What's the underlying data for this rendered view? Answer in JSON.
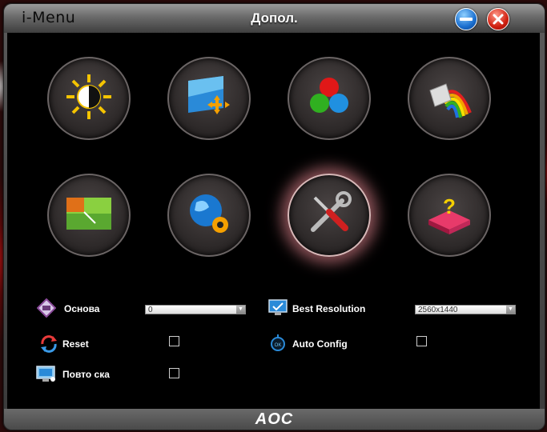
{
  "window": {
    "app_name": "i-Menu",
    "title": "Допол."
  },
  "titlebar_buttons": [
    "minimize-icon",
    "close-icon"
  ],
  "tiles": [
    {
      "name": "brightness-contrast-icon"
    },
    {
      "name": "image-position-icon"
    },
    {
      "name": "color-rgb-icon"
    },
    {
      "name": "color-boost-icon"
    },
    {
      "name": "picture-boost-icon"
    },
    {
      "name": "osd-setup-icon"
    },
    {
      "name": "extra-tools-icon",
      "active": true
    },
    {
      "name": "factory-reset-icon"
    }
  ],
  "settings": {
    "basic_label": "Основа",
    "basic_value": "0",
    "best_resolution_label": "Best Resolution",
    "best_resolution_value": "2560x1440",
    "reset_label": "Reset",
    "auto_config_label": "Auto Config",
    "repeat_label": "Повто ска",
    "reset_checked": false,
    "auto_config_checked": false,
    "repeat_checked": false
  },
  "footer": {
    "brand": "AOC"
  },
  "colors": {
    "accent_red": "#d02010",
    "accent_blue": "#1a6fd0",
    "active_glow": "#ff96a0"
  }
}
